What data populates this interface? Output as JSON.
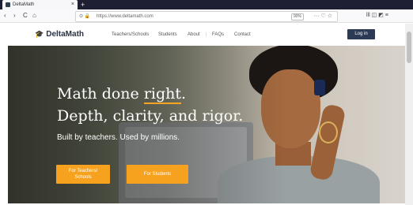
{
  "browser": {
    "tab_title": "DeltaMath",
    "tab_close": "×",
    "new_tab": "+",
    "nav_back": "‹",
    "nav_forward": "›",
    "nav_reload": "C",
    "nav_home": "⌂",
    "url_icons": "⊙ 🔒",
    "url": "https://www.deltamath.com",
    "zoom": "90%",
    "url_actions": "··· ♡ ☆",
    "toolbar_right": "lll ◫ ◩ ≡"
  },
  "site": {
    "logo_text": "DeltaMath",
    "logo_icon": "🎓",
    "nav": {
      "teachers_schools": "Teachers/Schools",
      "students": "Students",
      "about": "About",
      "sep": "|",
      "faqs": "FAQs",
      "contact": "Contact"
    },
    "login": "Log in"
  },
  "hero": {
    "title_part1": "Math done ",
    "title_highlight": "right",
    "title_part2": ".",
    "title_line2": "Depth, clarity, and rigor.",
    "subtitle": "Built by teachers. Used by millions.",
    "btn_teachers_line1": "For Teachers/",
    "btn_teachers_line2": "Schools",
    "btn_students": "For Students"
  },
  "colors": {
    "accent": "#f6a21e",
    "login_bg": "#2b3a55",
    "tabbar_bg": "#1f1f33"
  }
}
